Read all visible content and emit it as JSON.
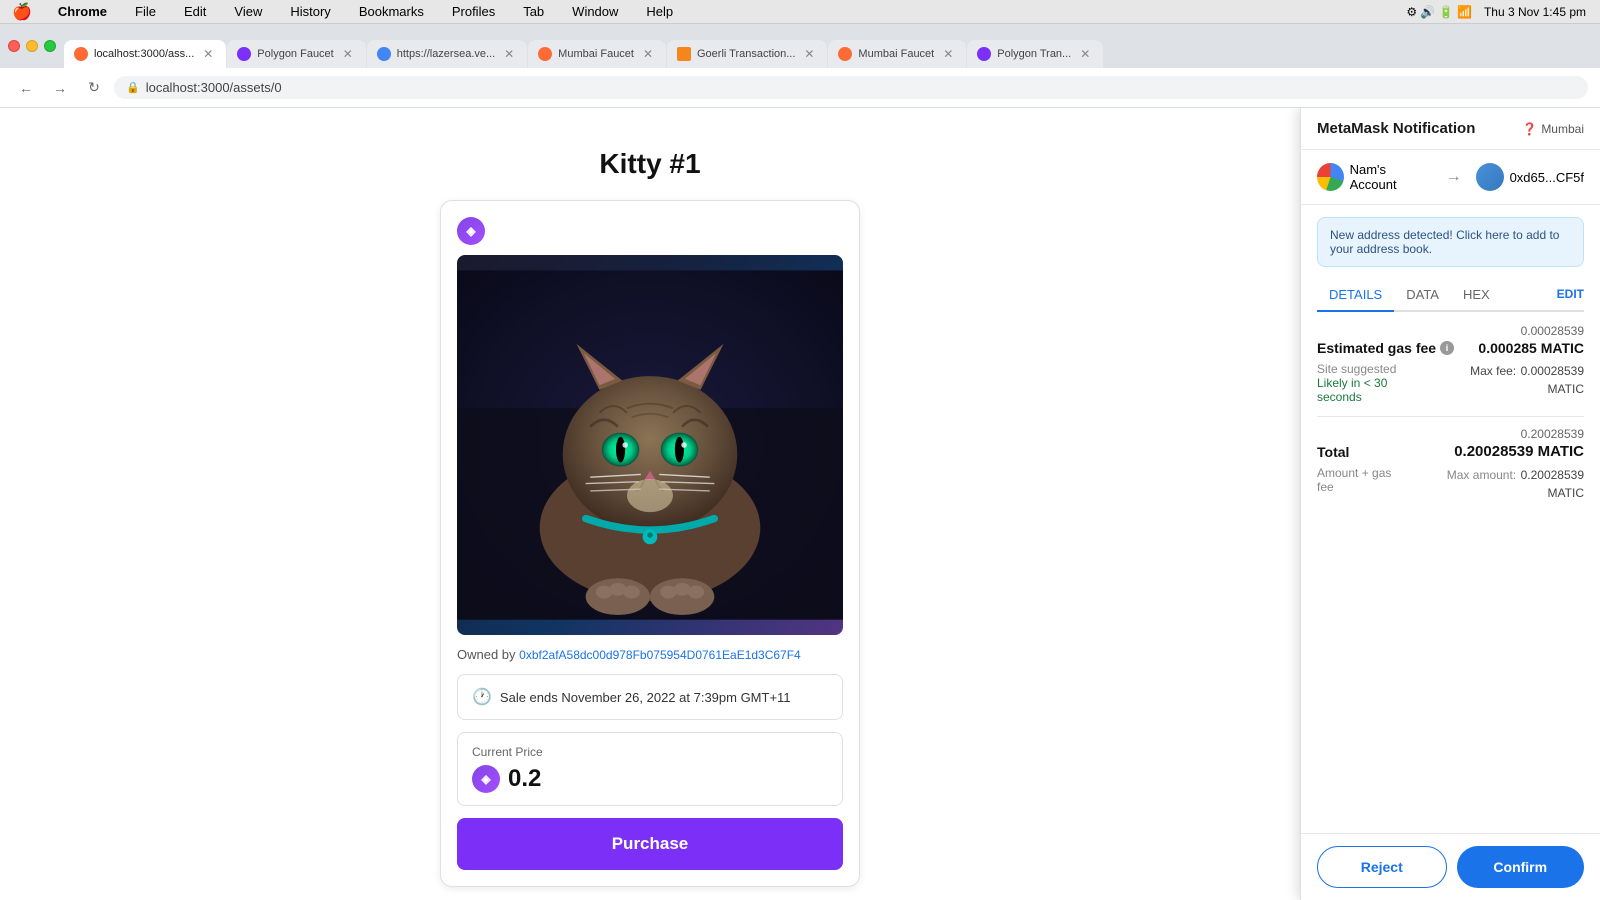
{
  "menubar": {
    "apple": "🍎",
    "items": [
      "Chrome",
      "File",
      "Edit",
      "View",
      "History",
      "Bookmarks",
      "Profiles",
      "Tab",
      "Window",
      "Help"
    ],
    "right": {
      "time": "Thu 3 Nov  1:45 pm"
    }
  },
  "browser": {
    "tabs": [
      {
        "id": "tab-1",
        "label": "localhost:3000/ass...",
        "active": true,
        "favicon_type": "orange",
        "closable": true
      },
      {
        "id": "tab-2",
        "label": "Polygon Faucet",
        "active": false,
        "favicon_type": "purple",
        "closable": true
      },
      {
        "id": "tab-3",
        "label": "https://lazersea.ve...",
        "active": false,
        "favicon_type": "blue",
        "closable": true
      },
      {
        "id": "tab-4",
        "label": "Mumbai Faucet",
        "active": false,
        "favicon_type": "orange",
        "closable": true
      },
      {
        "id": "tab-5",
        "label": "Goerli Transaction...",
        "active": false,
        "favicon_type": "metamask",
        "closable": true
      },
      {
        "id": "tab-6",
        "label": "Mumbai Faucet",
        "active": false,
        "favicon_type": "orange",
        "closable": true
      },
      {
        "id": "tab-7",
        "label": "Polygon Tran...",
        "active": false,
        "favicon_type": "purple",
        "closable": true
      }
    ],
    "url": "localhost:3000/assets/0"
  },
  "page": {
    "title": "Kitty #1",
    "owned_by_label": "Owned by",
    "owner_address": "0xbf2afA58dc00d978Fb075954D0761EaE1d3C67F4",
    "sale_ends": "Sale ends November 26, 2022 at 7:39pm GMT+11",
    "current_price_label": "Current Price",
    "price": "0.2",
    "purchase_label": "Purchase"
  },
  "metamask": {
    "title": "MetaMask Notification",
    "network": "Mumbai",
    "from_account": "Nam's Account",
    "to_address": "0xd65...CF5f",
    "notice": "New address detected! Click here to add to your address book.",
    "tabs": [
      "DETAILS",
      "DATA",
      "HEX"
    ],
    "active_tab": "DETAILS",
    "edit_label": "EDIT",
    "gas_fee_label": "Estimated gas fee",
    "gas_fee_amount_small": "0.00028539",
    "gas_fee_matic": "0.000285 MATIC",
    "site_suggested_label": "Site suggested",
    "likely_label": "Likely in < 30 seconds",
    "max_fee_label": "Max fee:",
    "max_fee_value": "0.00028539 MATIC",
    "total_label": "Total",
    "total_amount_small": "0.20028539",
    "total_matic": "0.20028539 MATIC",
    "amount_gas_label": "Amount + gas fee",
    "max_amount_label": "Max amount:",
    "max_amount_value": "0.20028539 MATIC",
    "reject_label": "Reject",
    "confirm_label": "Confirm"
  }
}
